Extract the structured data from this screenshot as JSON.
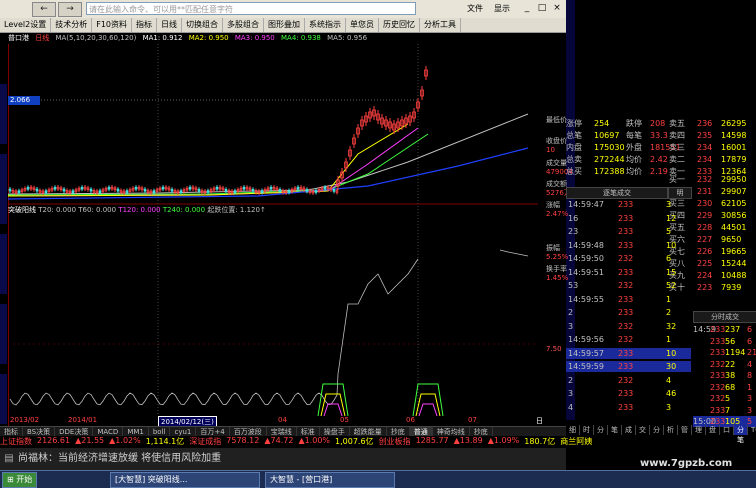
{
  "titlebar": {
    "back": "←",
    "forward": "→",
    "search_placeholder": "请在此输入命令、可以用**匹配任意字符",
    "menu_file": "文件",
    "menu_view": "显示",
    "min": "_",
    "max": "□",
    "close": "×"
  },
  "menubar": [
    "Level2设置",
    "技术分析",
    "F10资料",
    "指标",
    "日线",
    "切换组合",
    "多股组合",
    "图形叠加",
    "系统指示",
    "单您员",
    "历史回忆",
    "分析工具"
  ],
  "mabar": {
    "stock": "普口港",
    "period": "日线",
    "ma_params": "MA(5,10,20,30,60,120)",
    "ma1": "MA1: 0.912",
    "ma2": "MA2: 0.950",
    "ma3": "MA3: 0.950",
    "ma4": "MA4: 0.938",
    "ma5": "MA5: 0.956"
  },
  "price_tag": "2.066",
  "indicator_bar": {
    "name": "突破阳线",
    "t20": "T20: 0.000",
    "t60": "T60: 0.000",
    "t120": "T120: 0.000",
    "t240": "T240: 0.000",
    "pos": "起跌位置: 1.120↑"
  },
  "scale_label": "7.50",
  "dates": {
    "d1": "2013/02",
    "d2": "2014/01",
    "current": "2014/02/12(三)",
    "d4": "04",
    "d5": "05",
    "d6": "06",
    "d7": "07",
    "corner": "日线"
  },
  "indicator_tabs": [
    "指标",
    "BS决策",
    "DDE决策",
    "MACD",
    "MM1",
    "boll",
    "cyu1",
    "百万+4",
    "百万波段",
    "宝瑞线",
    "标准",
    "操盘手",
    "超跌能量",
    "抄底",
    "普通",
    "神奇均线",
    "抄底"
  ],
  "ticker": {
    "sh_name": "上证指数",
    "sh_val": "2126.61",
    "sh_chg": "▲21.55",
    "sh_pct": "▲1.02%",
    "sh_amt": "1,114.1亿",
    "sz_name": "深证成指",
    "sz_val": "7578.12",
    "sz_chg": "▲74.72",
    "sz_pct": "▲1.00%",
    "sz_amt": "1,007.6亿",
    "cy_name": "创业板指",
    "cy_val": "1285.77",
    "cy_chg": "▲13.89",
    "cy_pct": "▲1.09%",
    "cy_amt": "180.7亿",
    "tail": "商兰阿姨"
  },
  "news": "尚福林：当前经济增速放缓 将使信用风险加重",
  "taskbar": {
    "start": "开始",
    "t1": "[大智慧] 突破阳线...",
    "t2": "大智慧 - [营口港]"
  },
  "watermark": "www.7gpzb.com",
  "right_panel": {
    "quote_labels": [
      {
        "k": "最低价",
        "v": ""
      },
      {
        "k": "收盘价",
        "v": "10"
      },
      {
        "k": "成交量",
        "v": "479004"
      },
      {
        "k": "成交额",
        "v": "5276万"
      },
      {
        "k": "涨幅",
        "v": "2.47%"
      },
      {
        "k": "振幅",
        "v": "5.25%"
      },
      {
        "k": "换手率",
        "v": "1.45%"
      }
    ],
    "summary": [
      {
        "a": "涨停",
        "b": "254",
        "c": "跌停",
        "d": "208"
      },
      {
        "a": "总笔",
        "b": "10697",
        "c": "每笔",
        "d": "33.3"
      },
      {
        "a": "内盘",
        "b": "175030",
        "c": "外盘",
        "d": "181551"
      },
      {
        "a": "总卖",
        "b": "272244",
        "c": "均价",
        "d": "2.42"
      },
      {
        "a": "总买",
        "b": "172388",
        "c": "均价",
        "d": "2.19"
      }
    ],
    "sell_orders": [
      {
        "lvl": "卖五",
        "price": "236",
        "vol": "26295"
      },
      {
        "lvl": "卖四",
        "price": "235",
        "vol": "14598"
      },
      {
        "lvl": "卖三",
        "price": "234",
        "vol": "16001"
      },
      {
        "lvl": "卖二",
        "price": "234",
        "vol": "17879"
      },
      {
        "lvl": "卖一",
        "price": "233",
        "vol": "12364"
      }
    ],
    "buy_orders": [
      {
        "lvl": "买一",
        "price": "232",
        "vol": "29950"
      },
      {
        "lvl": "买二",
        "price": "231",
        "vol": "29907"
      },
      {
        "lvl": "买三",
        "price": "230",
        "vol": "62105"
      },
      {
        "lvl": "买四",
        "price": "229",
        "vol": "30856"
      },
      {
        "lvl": "买五",
        "price": "228",
        "vol": "44501"
      },
      {
        "lvl": "买六",
        "price": "227",
        "vol": "9650"
      },
      {
        "lvl": "买七",
        "price": "226",
        "vol": "19665"
      },
      {
        "lvl": "买八",
        "price": "225",
        "vol": "15244"
      },
      {
        "lvl": "买九",
        "price": "224",
        "vol": "10488"
      },
      {
        "lvl": "买十",
        "price": "223",
        "vol": "7939"
      }
    ],
    "trades_header": "逐笔成交",
    "trades_hdr_right": "明",
    "trades": [
      {
        "t": "14:59:47",
        "p": "233",
        "v": "3"
      },
      {
        "t": "16",
        "p": "233",
        "v": "12"
      },
      {
        "t": "23",
        "p": "233",
        "v": "5"
      },
      {
        "t": "14:59:48",
        "p": "233",
        "v": "10"
      },
      {
        "t": "14:59:50",
        "p": "232",
        "v": "6"
      },
      {
        "t": "14:59:51",
        "p": "233",
        "v": "15"
      },
      {
        "t": "53",
        "p": "232",
        "v": "52"
      },
      {
        "t": "14:59:55",
        "p": "233",
        "v": "1"
      },
      {
        "t": "2",
        "p": "233",
        "v": "2"
      },
      {
        "t": "3",
        "p": "232",
        "v": "32"
      },
      {
        "t": "14:59:56",
        "p": "232",
        "v": "1"
      },
      {
        "t": "14:59:57",
        "p": "233",
        "v": "10"
      },
      {
        "t": "14:59:59",
        "p": "233",
        "v": "30"
      },
      {
        "t": "2",
        "p": "232",
        "v": "4"
      },
      {
        "t": "3",
        "p": "233",
        "v": "46"
      },
      {
        "t": "4",
        "p": "233",
        "v": "3"
      }
    ],
    "min_header": "分时成交",
    "mins": [
      {
        "t": "14:59",
        "p": "233",
        "v": "237",
        "c": "6"
      },
      {
        "t": "",
        "p": "233",
        "v": "56",
        "c": "6"
      },
      {
        "t": "",
        "p": "233",
        "v": "1194",
        "c": "21"
      },
      {
        "t": "",
        "p": "232",
        "v": "22",
        "c": "4"
      },
      {
        "t": "",
        "p": "233",
        "v": "38",
        "c": "8"
      },
      {
        "t": "",
        "p": "232",
        "v": "68",
        "c": "1"
      },
      {
        "t": "",
        "p": "232",
        "v": "5",
        "c": "3"
      },
      {
        "t": "",
        "p": "233",
        "v": "7",
        "c": "3"
      },
      {
        "t": "15:00",
        "p": "233",
        "v": "105",
        "c": "5"
      }
    ],
    "tabs": [
      "细",
      "时",
      "分",
      "笔",
      "成",
      "交",
      "分",
      "析",
      "管",
      "理",
      "盘",
      "口"
    ],
    "bottom_tabs": [
      "分笔",
      "TOP",
      "委托"
    ]
  }
}
